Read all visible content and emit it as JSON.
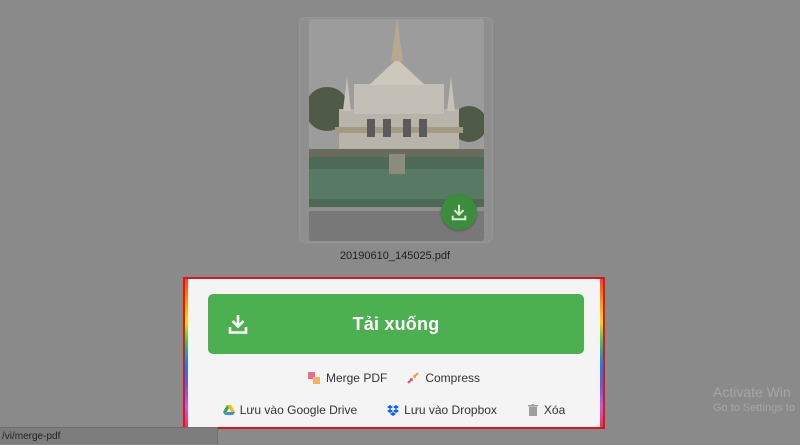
{
  "preview": {
    "file_name": "20190610_145025.pdf"
  },
  "actions": {
    "download_label": "Tải xuống",
    "merge_label": "Merge PDF",
    "compress_label": "Compress",
    "google_drive_label": "Lưu vào Google Drive",
    "dropbox_label": "Lưu vào Dropbox",
    "delete_label": "Xóa"
  },
  "status_bar": {
    "url": "/vi/merge-pdf"
  },
  "watermark": {
    "title": "Activate Win",
    "subtitle": "Go to Settings to"
  },
  "colors": {
    "primary_green": "#4caf50",
    "highlight_border": "#d91818"
  }
}
